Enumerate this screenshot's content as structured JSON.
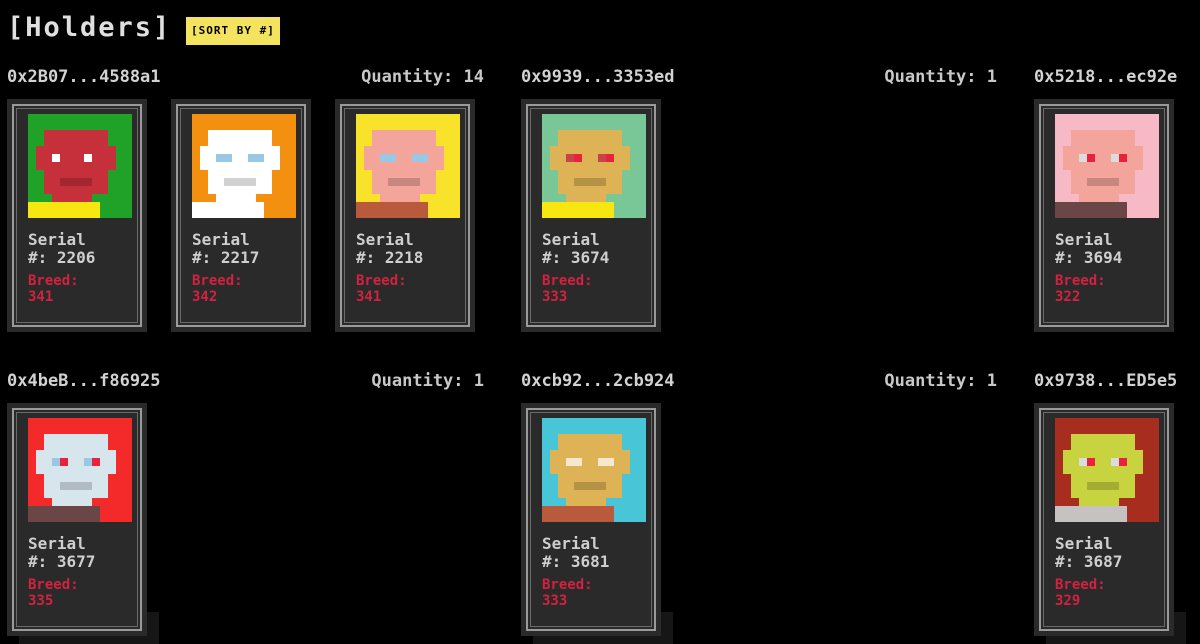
{
  "page": {
    "title": "[Holders]",
    "sort_label": "[SORT BY #]"
  },
  "colors": {
    "background": "#000000",
    "sort_button": "#f4e35e",
    "breed_text": "#d3223f",
    "card": "#2a2a2a"
  },
  "holders": [
    {
      "address": "0x2B07...4588a1",
      "quantity": "Quantity: 14",
      "cards": [
        {
          "serial_line1": "Serial",
          "serial_line2": "#: 2206",
          "breed_label": "Breed:",
          "breed_value": "341",
          "colors": {
            "bg": "#1fa227",
            "skin": "#c6303a",
            "eyes": "#ffffff",
            "pupil": "#c6303a",
            "shirt": "#f6e711"
          }
        },
        {
          "serial_line1": "Serial",
          "serial_line2": "#: 2217",
          "breed_label": "Breed:",
          "breed_value": "342",
          "colors": {
            "bg": "#f3900f",
            "skin": "#ffffff",
            "eyes": "#9ac7e4",
            "pupil": "#9ac7e4",
            "shirt": "#ffffff"
          }
        },
        {
          "serial_line1": "Serial",
          "serial_line2": "#: 2218",
          "breed_label": "Breed:",
          "breed_value": "341",
          "colors": {
            "bg": "#f9e22a",
            "skin": "#f3a59b",
            "eyes": "#9ac7e4",
            "pupil": "#9ac7e4",
            "shirt": "#b95a3d"
          }
        }
      ]
    },
    {
      "address": "0x9939...3353ed",
      "quantity": "Quantity: 1",
      "cards": [
        {
          "serial_line1": "Serial",
          "serial_line2": "#: 3674",
          "breed_label": "Breed:",
          "breed_value": "333",
          "colors": {
            "bg": "#79c796",
            "skin": "#ddb355",
            "eyes": "#c9424a",
            "pupil": "#e8223d",
            "shirt": "#f6e711"
          }
        }
      ]
    },
    {
      "address": "0x5218...ec92e",
      "quantity": "",
      "cards": [
        {
          "serial_line1": "Serial",
          "serial_line2": "#: 3694",
          "breed_label": "Breed:",
          "breed_value": "322",
          "colors": {
            "bg": "#f8b9c6",
            "skin": "#f3a59b",
            "eyes": "#dcdcdc",
            "pupil": "#e8223d",
            "shirt": "#6a4646"
          }
        }
      ]
    },
    {
      "address": "0x4beB...f86925",
      "quantity": "Quantity: 1",
      "cards": [
        {
          "serial_line1": "Serial",
          "serial_line2": "#: 3677",
          "breed_label": "Breed:",
          "breed_value": "335",
          "colors": {
            "bg": "#f42a2a",
            "skin": "#d7e6ec",
            "eyes": "#9ac7e4",
            "pupil": "#e8223d",
            "shirt": "#6a4646"
          }
        }
      ]
    },
    {
      "address": "0xcb92...2cb924",
      "quantity": "Quantity: 1",
      "cards": [
        {
          "serial_line1": "Serial",
          "serial_line2": "#: 3681",
          "breed_label": "Breed:",
          "breed_value": "333",
          "colors": {
            "bg": "#48c6d8",
            "skin": "#ddb355",
            "eyes": "#f7e8d2",
            "pupil": "#f7e8d2",
            "shirt": "#b95a3d"
          }
        }
      ]
    },
    {
      "address": "0x9738...ED5e5",
      "quantity": "",
      "cards": [
        {
          "serial_line1": "Serial",
          "serial_line2": "#: 3687",
          "breed_label": "Breed:",
          "breed_value": "329",
          "colors": {
            "bg": "#a72d1e",
            "skin": "#c7d33f",
            "eyes": "#dcdcdc",
            "pupil": "#e8223d",
            "shirt": "#c7c2c2"
          }
        }
      ]
    }
  ]
}
